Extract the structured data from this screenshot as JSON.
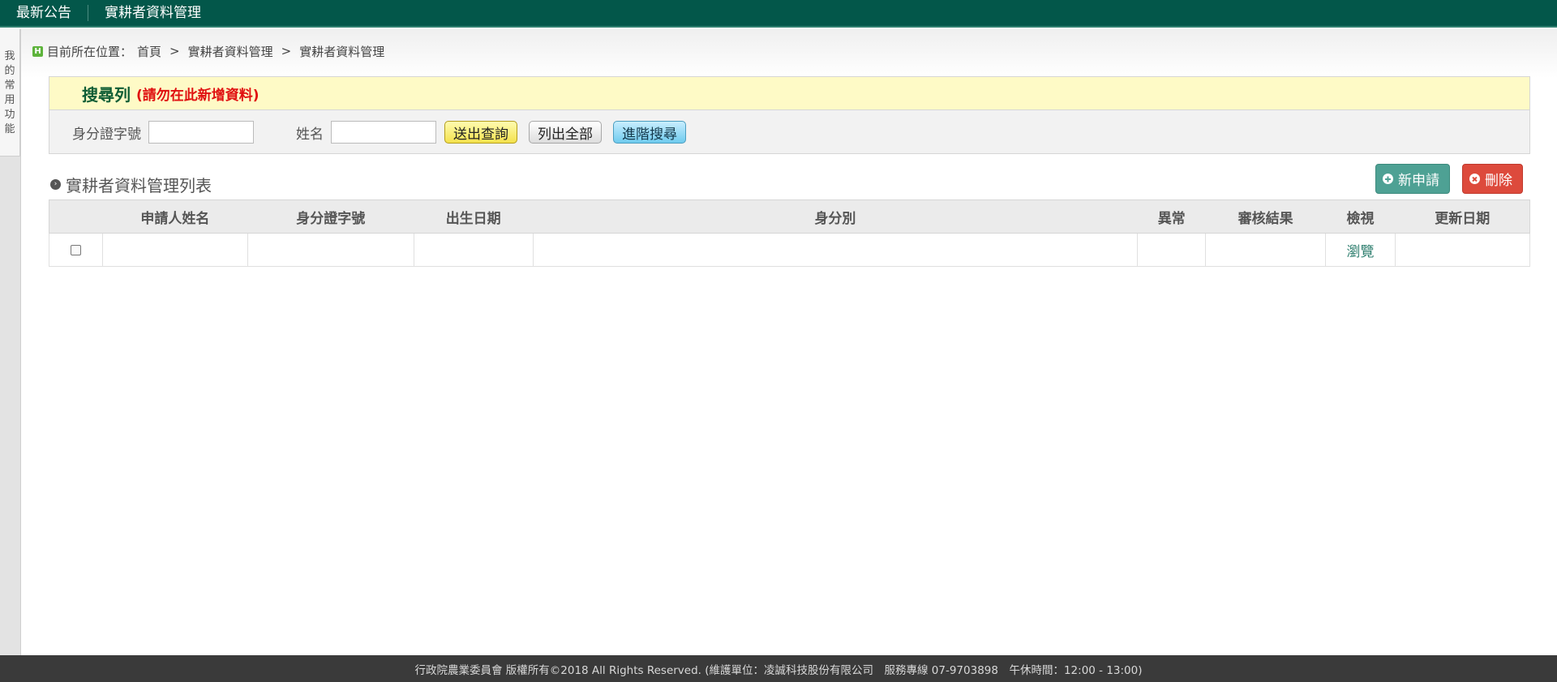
{
  "topnav": {
    "items": [
      "最新公告",
      "實耕者資料管理"
    ]
  },
  "sidebar": {
    "tab_label": "我的常用功能"
  },
  "breadcrumb": {
    "icon_letter": "H",
    "prefix": "目前所在位置：",
    "items": [
      "首頁",
      "實耕者資料管理",
      "實耕者資料管理"
    ],
    "separator": ">"
  },
  "search": {
    "title": "搜尋列",
    "warning": "(請勿在此新增資料)",
    "id_label": "身分證字號",
    "id_value": "",
    "name_label": "姓名",
    "name_value": "",
    "submit_label": "送出查詢",
    "list_all_label": "列出全部",
    "advanced_label": "進階搜尋"
  },
  "list": {
    "title": "實耕者資料管理列表",
    "apply_label": "新申請",
    "delete_label": "刪除",
    "columns": [
      "",
      "申請人姓名",
      "身分證字號",
      "出生日期",
      "身分別",
      "異常",
      "審核結果",
      "檢視",
      "更新日期"
    ],
    "rows": [
      {
        "name": "",
        "id": "",
        "birth": "",
        "identity": "",
        "abnormal": "",
        "result": "",
        "view": "瀏覽",
        "updated": ""
      }
    ]
  },
  "footer": {
    "text": "行政院農業委員會 版權所有©2018 All Rights Reserved. (維護單位：凌誠科技股份有限公司　服務專線 07-9703898　午休時間：12:00 - 13:00)"
  },
  "colors": {
    "topnav_bg": "#03574a",
    "search_head_bg": "#fefac6",
    "apply_btn": "#4ea194",
    "delete_btn": "#dd4a3c",
    "warning_text": "#e01010",
    "footer_bg": "#3a3a3a"
  }
}
